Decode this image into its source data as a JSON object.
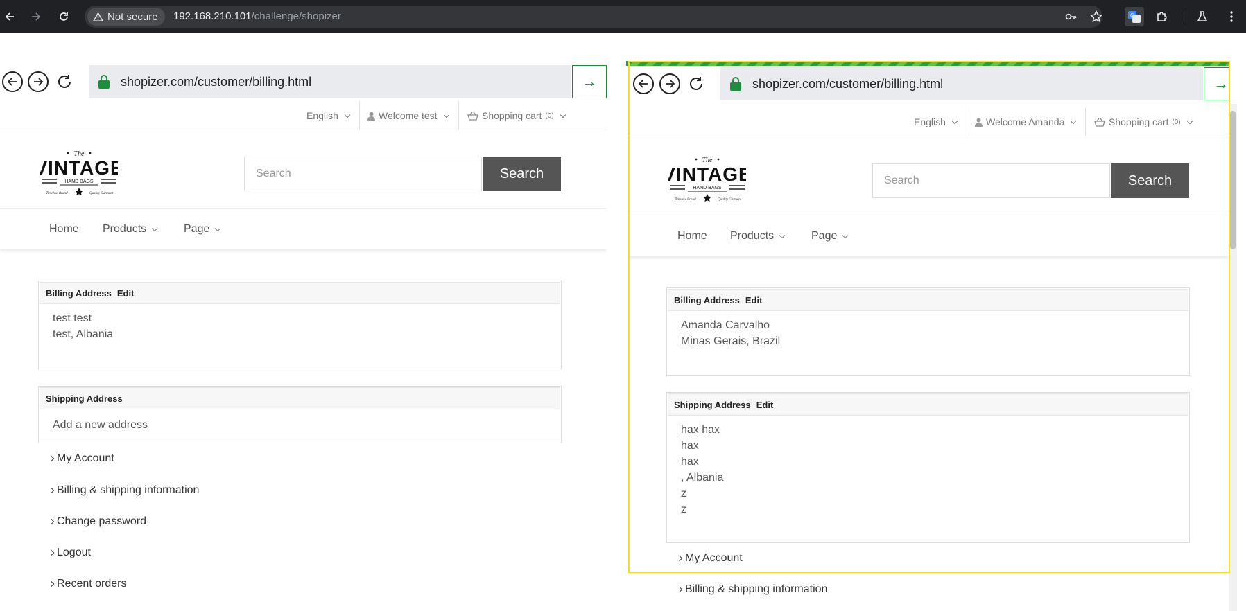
{
  "browser": {
    "security_label": "Not secure",
    "url_host": "192.168.210.101",
    "url_path": "/challenge/shopizer"
  },
  "left": {
    "url": "shopizer.com/customer/billing.html",
    "topbar": {
      "language": "English",
      "welcome": "Welcome test",
      "cart": "Shopping cart",
      "cart_count": "(0)"
    },
    "search": {
      "placeholder": "Search",
      "button": "Search"
    },
    "menu": {
      "home": "Home",
      "products": "Products",
      "page": "Page"
    },
    "billing": {
      "title": "Billing Address",
      "edit": "Edit",
      "lines": [
        "test test",
        "test, Albania"
      ]
    },
    "shipping": {
      "title": "Shipping Address",
      "add": "Add a new address"
    },
    "account_links": [
      "My Account",
      "Billing & shipping information",
      "Change password",
      "Logout",
      "Recent orders"
    ]
  },
  "right": {
    "url": "shopizer.com/customer/billing.html",
    "topbar": {
      "language": "English",
      "welcome": "Welcome Amanda",
      "cart": "Shopping cart",
      "cart_count": "(0)"
    },
    "search": {
      "placeholder": "Search",
      "button": "Search"
    },
    "menu": {
      "home": "Home",
      "products": "Products",
      "page": "Page"
    },
    "billing": {
      "title": "Billing Address",
      "edit": "Edit",
      "lines": [
        "Amanda Carvalho",
        "Minas Gerais, Brazil"
      ]
    },
    "shipping": {
      "title": "Shipping Address",
      "edit": "Edit",
      "lines": [
        "hax hax",
        "hax",
        "hax",
        ", Albania",
        "z",
        "z"
      ]
    },
    "account_links": [
      "My Account",
      "Billing & shipping information"
    ]
  },
  "logo": {
    "top": "The",
    "main": "VINTAGE",
    "sub": "HAND BAGS",
    "foot_left": "Timeless Brand",
    "foot_right": "Quality Garment"
  },
  "colors": {
    "accent_green": "#1e8e3e",
    "highlight": "#f5e11a",
    "search_button": "#555555"
  }
}
